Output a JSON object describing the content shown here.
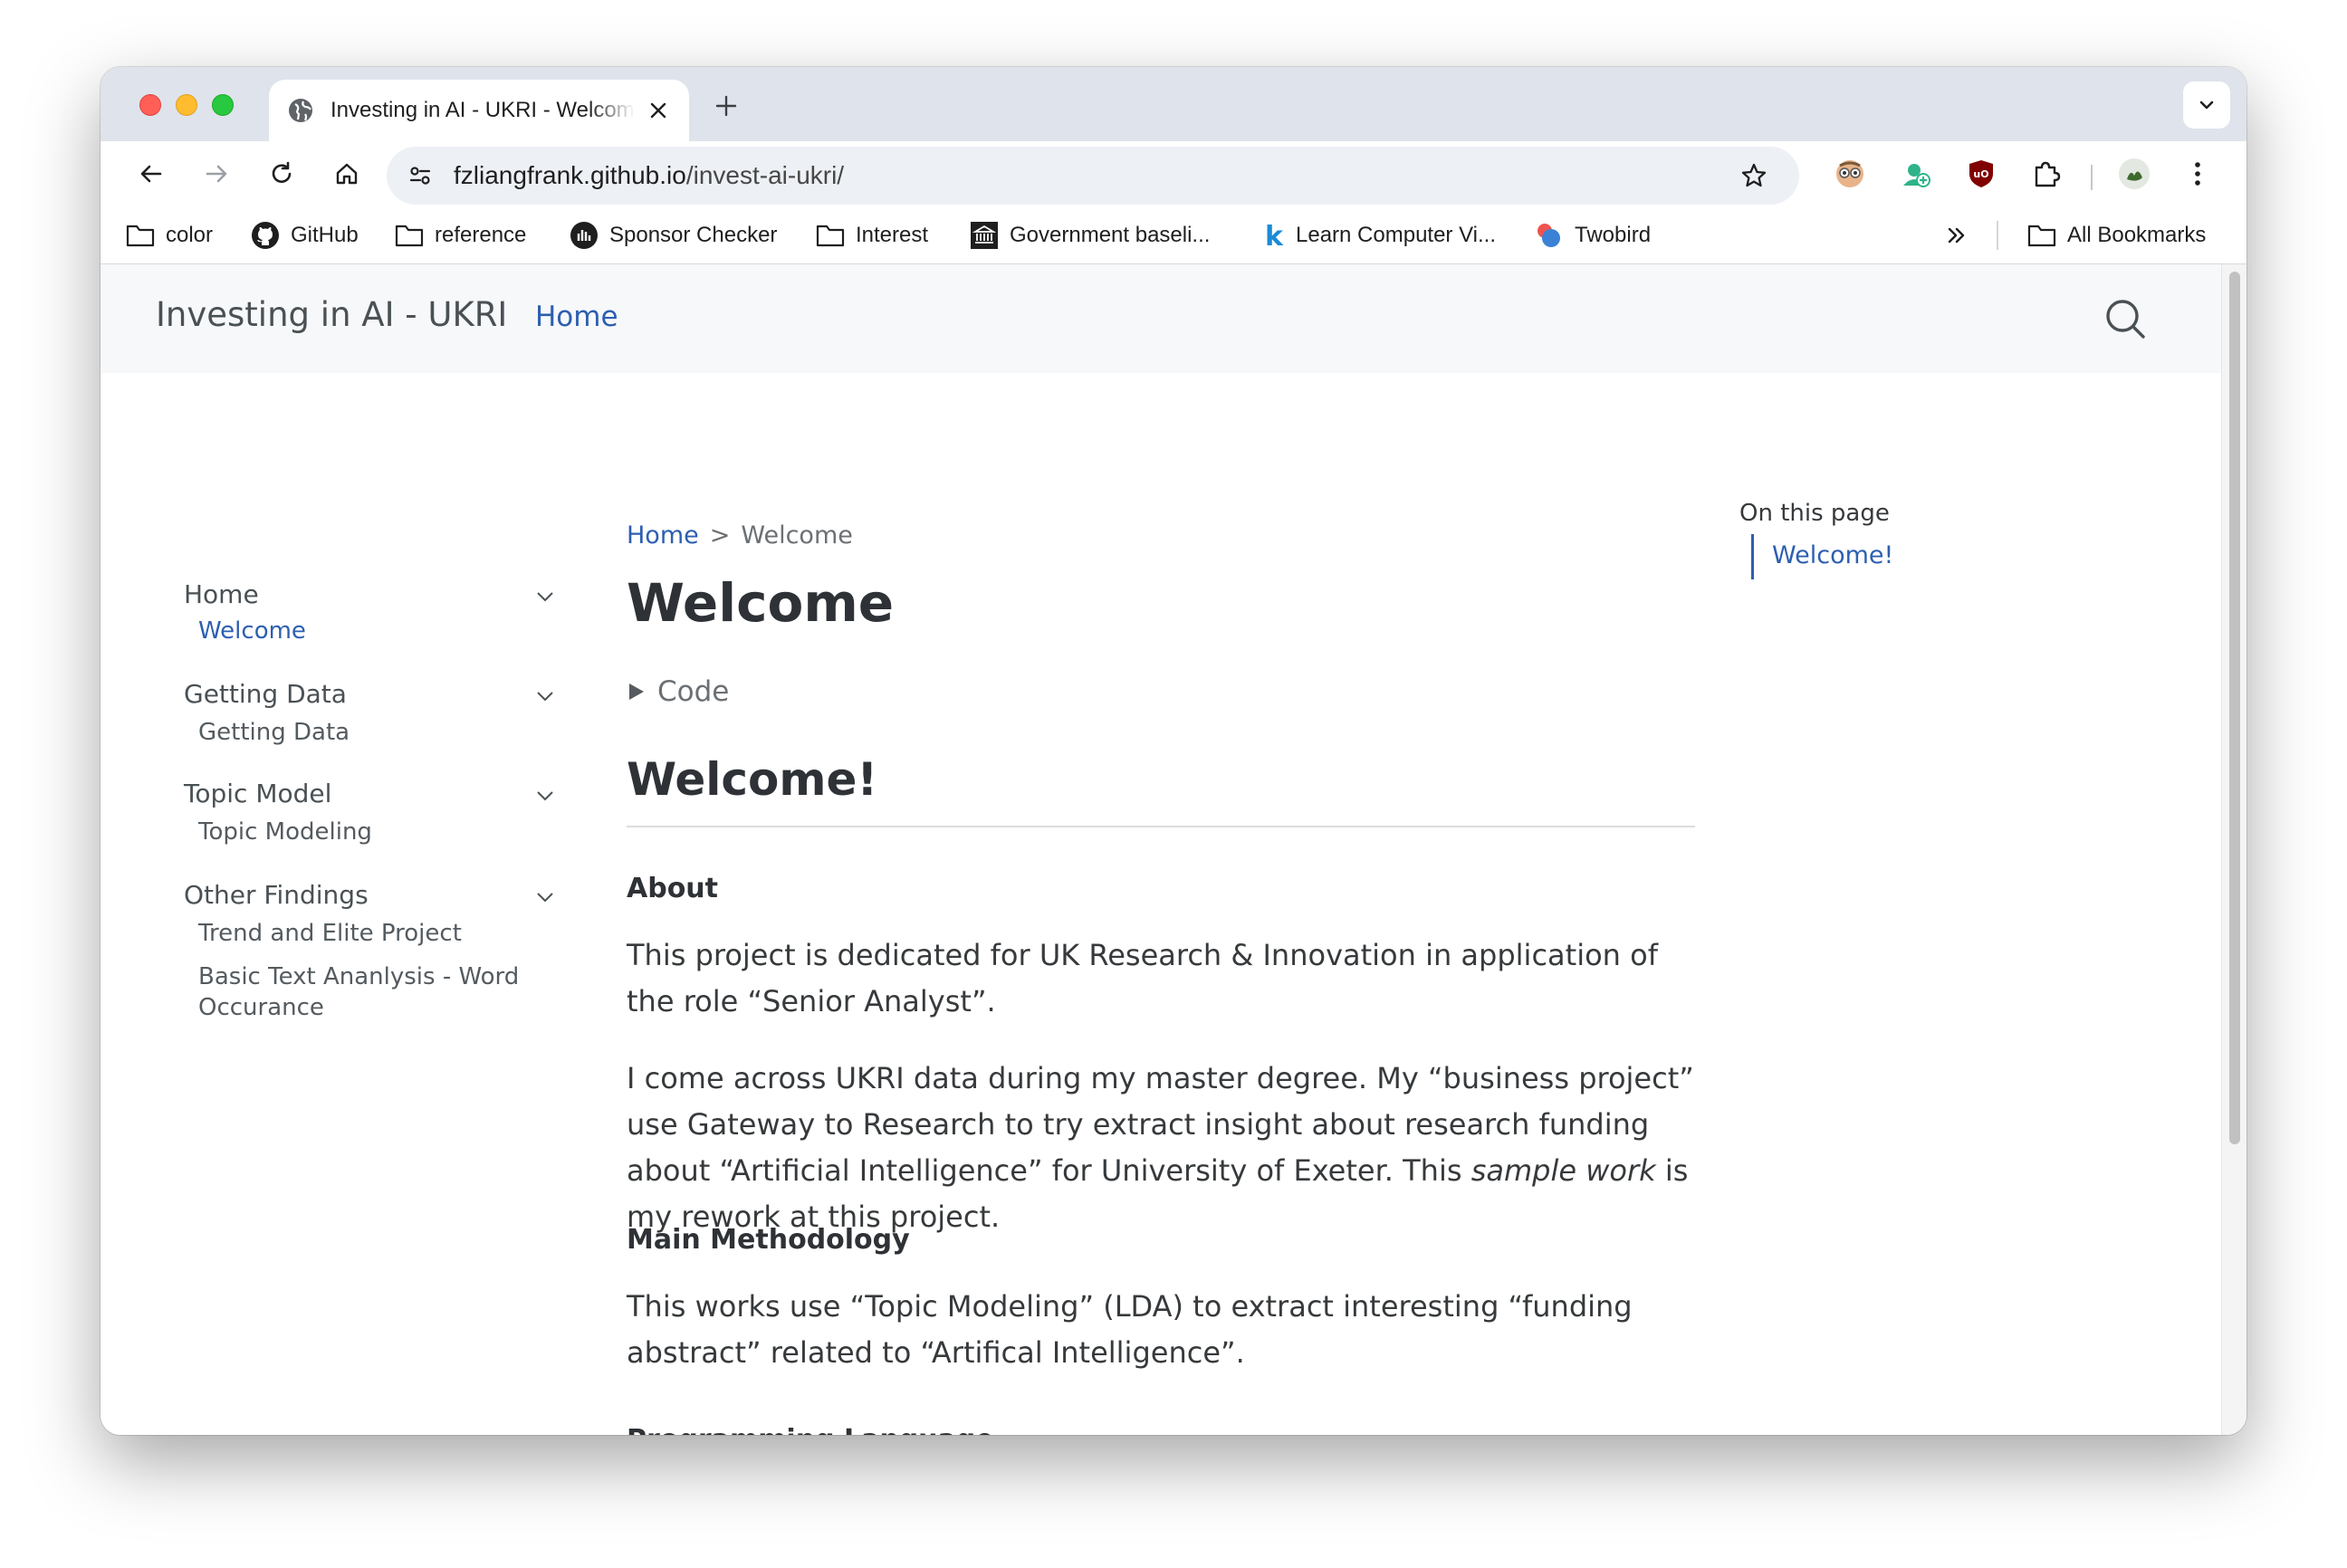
{
  "browser": {
    "tab": {
      "title": "Investing in AI - UKRI - Welcome",
      "favicon": "globe-icon"
    },
    "url": {
      "domain": "fzliangfrank.github.io",
      "path": "/invest-ai-ukri/"
    },
    "bookmarks": [
      {
        "label": "color",
        "icon": "folder-icon"
      },
      {
        "label": "GitHub",
        "icon": "github-icon"
      },
      {
        "label": "reference",
        "icon": "folder-icon"
      },
      {
        "label": "Sponsor Checker",
        "icon": "sponsor-checker-icon"
      },
      {
        "label": "Interest",
        "icon": "folder-icon"
      },
      {
        "label": "Government baseli...",
        "icon": "government-icon"
      },
      {
        "label": "Learn Computer Vi...",
        "icon": "k-letter-icon"
      },
      {
        "label": "Twobird",
        "icon": "twobird-icon"
      }
    ],
    "all_bookmarks_label": "All Bookmarks"
  },
  "site": {
    "title": "Investing in AI - UKRI",
    "nav_home": "Home",
    "accent_color": "#2d5fb0"
  },
  "sidebar": {
    "sections": [
      {
        "label": "Home",
        "items": [
          "Welcome"
        ]
      },
      {
        "label": "Getting Data",
        "items": [
          "Getting Data"
        ]
      },
      {
        "label": "Topic Model",
        "items": [
          "Topic Modeling"
        ]
      },
      {
        "label": "Other Findings",
        "items": [
          "Trend and Elite Project",
          "Basic Text Ananlysis - Word Occurance"
        ]
      }
    ]
  },
  "main": {
    "breadcrumb": {
      "home": "Home",
      "separator": ">",
      "current": "Welcome"
    },
    "title": "Welcome",
    "code_toggle": "Code",
    "h2": "Welcome!",
    "about_heading": "About",
    "about_para": "This project is dedicated for UK Research & Innovation in application of the role “Senior Analyst”.",
    "para2_a": "I come across UKRI data during my master degree. My “business project” use Gateway to Research to try extract insight about research funding about “Artificial Intelligence” for University of Exeter. This ",
    "para2_em": "sample work",
    "para2_b": " is my rework at this project.",
    "method_heading": "Main Methodology",
    "method_para": "This works use “Topic Modeling” (LDA) to extract interesting “funding abstract” related to “Artifical Intelligence”.",
    "lang_heading": "Programming Language"
  },
  "toc": {
    "title": "On this page",
    "items": [
      "Welcome!"
    ]
  }
}
